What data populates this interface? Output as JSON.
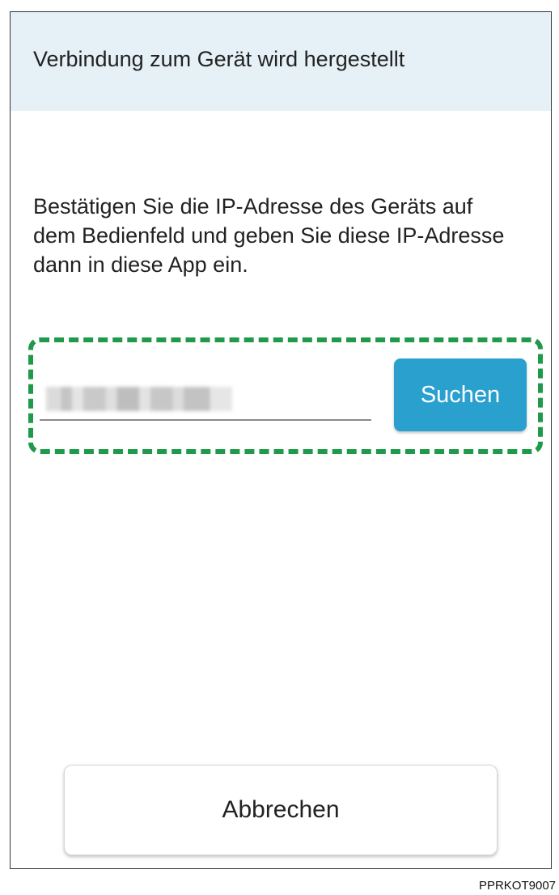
{
  "dialog": {
    "title": "Verbindung zum Gerät wird hergestellt",
    "instructions": "Bestätigen Sie die IP-Adresse des Geräts auf dem Bedienfeld und geben Sie diese IP-Adresse dann in diese App ein."
  },
  "ip_input": {
    "value": ""
  },
  "buttons": {
    "search_label": "Suchen",
    "cancel_label": "Abbrechen"
  },
  "colors": {
    "title_bar": "#e6f1f7",
    "search_button": "#2aa0cf",
    "highlight_dashes": "#1f9a4a"
  },
  "figure_code": "PPRKOT9007"
}
